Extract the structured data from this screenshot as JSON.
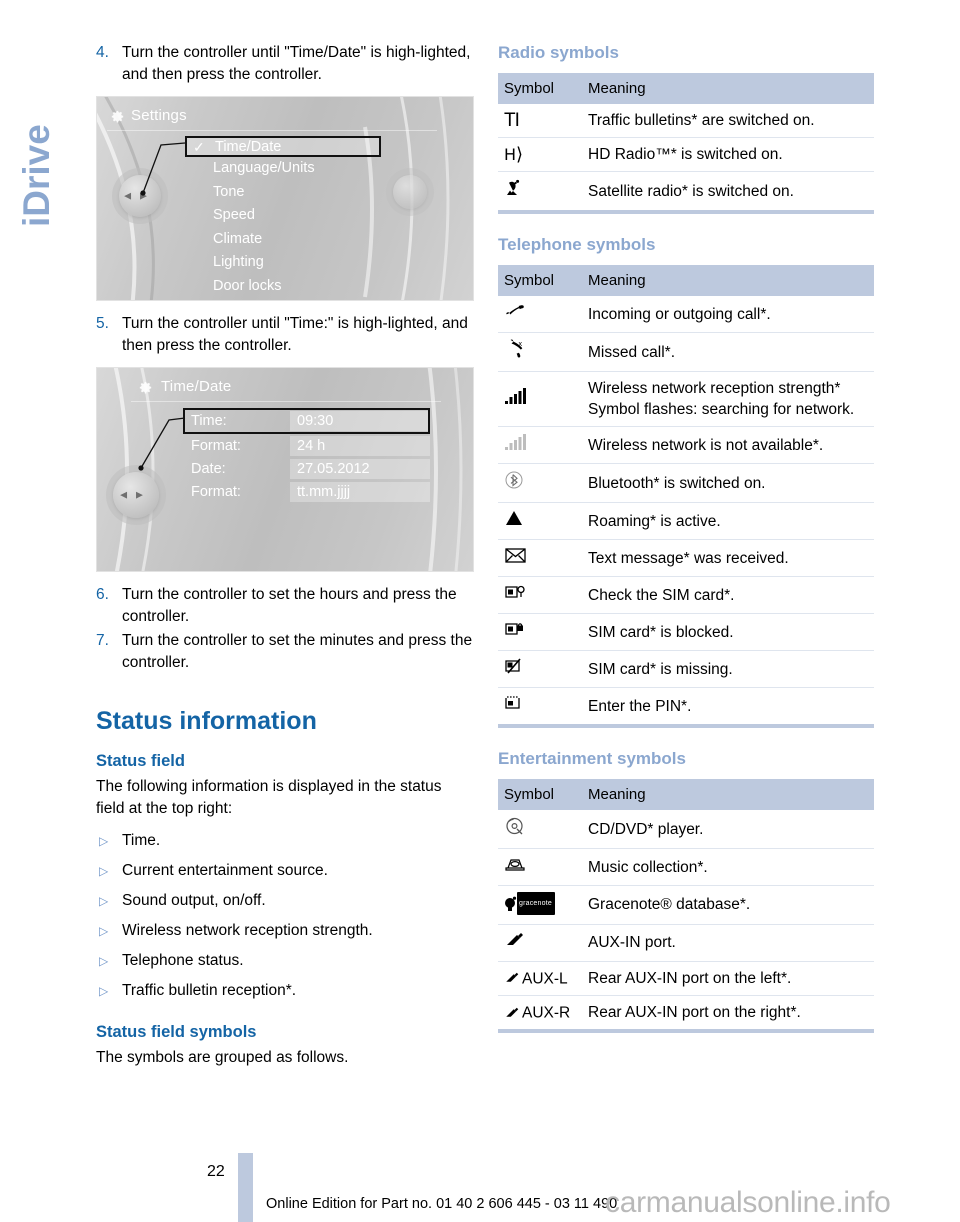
{
  "chapter_tab": {
    "label": "iDrive"
  },
  "left_column": {
    "steps_top": [
      {
        "num": "4.",
        "text": "Turn the controller until \"Time/Date\" is high-lighted, and then press the controller."
      }
    ],
    "settings_screen": {
      "title": "Settings",
      "gear_icon": "gear-icon",
      "items": [
        {
          "label": "Time/Date",
          "selected": true,
          "check": "✓"
        },
        {
          "label": "Language/Units",
          "selected": false
        },
        {
          "label": "Tone",
          "selected": false
        },
        {
          "label": "Speed",
          "selected": false
        },
        {
          "label": "Climate",
          "selected": false
        },
        {
          "label": "Lighting",
          "selected": false
        },
        {
          "label": "Door locks",
          "selected": false
        }
      ]
    },
    "steps_mid": [
      {
        "num": "5.",
        "text": "Turn the controller until \"Time:\" is high-lighted, and then press the controller."
      }
    ],
    "timedate_screen": {
      "title": "Time/Date",
      "gear_icon": "gear-icon",
      "rows": [
        {
          "key": "Time:",
          "value": "09:30",
          "selected": true
        },
        {
          "key": "Format:",
          "value": "24 h",
          "selected": false
        },
        {
          "key": "Date:",
          "value": "27.05.2012",
          "selected": false
        },
        {
          "key": "Format:",
          "value": "tt.mm.jjjj",
          "selected": false
        }
      ]
    },
    "steps_bottom": [
      {
        "num": "6.",
        "text": "Turn the controller to set the hours and press the controller."
      },
      {
        "num": "7.",
        "text": "Turn the controller to set the minutes and press the controller."
      }
    ],
    "status_information": {
      "heading": "Status information",
      "status_field": {
        "heading": "Status field",
        "intro": "The following information is displayed in the status field at the top right:",
        "bullets": [
          "Time.",
          "Current entertainment source.",
          "Sound output, on/off.",
          "Wireless network reception strength.",
          "Telephone status.",
          "Traffic bulletin reception*."
        ]
      },
      "status_field_symbols": {
        "heading": "Status field symbols",
        "text": "The symbols are grouped as follows."
      }
    }
  },
  "right_column": {
    "radio": {
      "heading": "Radio symbols",
      "columns": [
        "Symbol",
        "Meaning"
      ],
      "rows": [
        {
          "symbol": "TI",
          "icon": "traffic-bulletin-icon",
          "meaning": "Traffic bulletins* are switched on."
        },
        {
          "symbol": "H⟩",
          "icon": "hd-radio-icon",
          "meaning": "HD Radio™* is switched on."
        },
        {
          "symbol": "὎1",
          "icon": "satellite-radio-icon",
          "meaning": "Satellite radio* is switched on."
        }
      ]
    },
    "telephone": {
      "heading": "Telephone symbols",
      "columns": [
        "Symbol",
        "Meaning"
      ],
      "rows": [
        {
          "symbol": "✆",
          "icon": "phone-handset-icon",
          "meaning": "Incoming or outgoing call*."
        },
        {
          "symbol": "✆",
          "icon": "missed-call-icon",
          "meaning": "Missed call*."
        },
        {
          "symbol": "▃",
          "icon": "signal-bars-icon",
          "meaning": "Wireless network reception strength* Symbol flashes: searching for network."
        },
        {
          "symbol": "▃",
          "icon": "signal-bars-dim-icon",
          "meaning": "Wireless network is not available*."
        },
        {
          "symbol": "Ⓑ",
          "icon": "bluetooth-icon",
          "meaning": "Bluetooth* is switched on."
        },
        {
          "symbol": "▲",
          "icon": "roaming-triangle-icon",
          "meaning": "Roaming* is active."
        },
        {
          "symbol": "✉",
          "icon": "envelope-icon",
          "meaning": "Text message* was received."
        },
        {
          "symbol": "▣",
          "icon": "sim-check-icon",
          "meaning": "Check the SIM card*."
        },
        {
          "symbol": "▣",
          "icon": "sim-blocked-icon",
          "meaning": "SIM card* is blocked."
        },
        {
          "symbol": "▣",
          "icon": "sim-missing-icon",
          "meaning": "SIM card* is missing."
        },
        {
          "symbol": "▣",
          "icon": "sim-pin-icon",
          "meaning": "Enter the PIN*."
        }
      ]
    },
    "entertainment": {
      "heading": "Entertainment symbols",
      "columns": [
        "Symbol",
        "Meaning"
      ],
      "rows": [
        {
          "symbol": "◎",
          "icon": "cd-dvd-icon",
          "meaning": "CD/DVD* player."
        },
        {
          "symbol": "▱",
          "icon": "music-collection-icon",
          "meaning": "Music collection*."
        },
        {
          "symbol": "gracenote",
          "icon": "gracenote-icon",
          "meaning": "Gracenote® database*."
        },
        {
          "symbol": "",
          "icon": "aux-plug-icon",
          "meaning": "AUX-IN port."
        },
        {
          "symbol": "AUX-L",
          "icon": "aux-plug-left-icon",
          "meaning": "Rear AUX-IN port on the left*."
        },
        {
          "symbol": "AUX-R",
          "icon": "aux-plug-right-icon",
          "meaning": "Rear AUX-IN port on the right*."
        }
      ]
    }
  },
  "footer": {
    "page_number": "22",
    "note": "Online Edition for Part no. 01 40 2 606 445 - 03 11 490",
    "watermark": "carmanualsonline.info"
  },
  "colors": {
    "heading_blue": "#1464a5",
    "soft_blue": "#8ba7cf",
    "table_header_bg": "#bdc9de",
    "row_divider": "#dfe5ee"
  }
}
